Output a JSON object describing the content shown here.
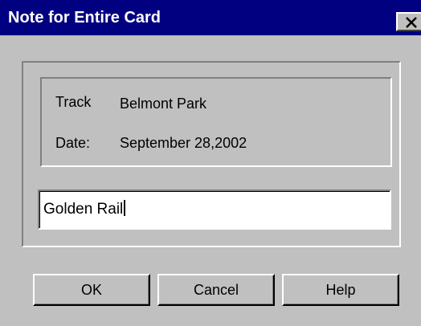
{
  "window": {
    "title": "Note for Entire Card"
  },
  "info": {
    "track_label": "Track",
    "track_value": "Belmont Park",
    "date_label": "Date:",
    "date_value": "September 28,2002"
  },
  "note": {
    "value": "Golden Rail"
  },
  "buttons": {
    "ok": "OK",
    "cancel": "Cancel",
    "help": "Help"
  },
  "icons": {
    "close": "close-icon"
  },
  "colors": {
    "titlebar": "#000080",
    "title_text": "#ffffff",
    "dialog_face": "#c0c0c0",
    "field_background": "#ffffff"
  }
}
